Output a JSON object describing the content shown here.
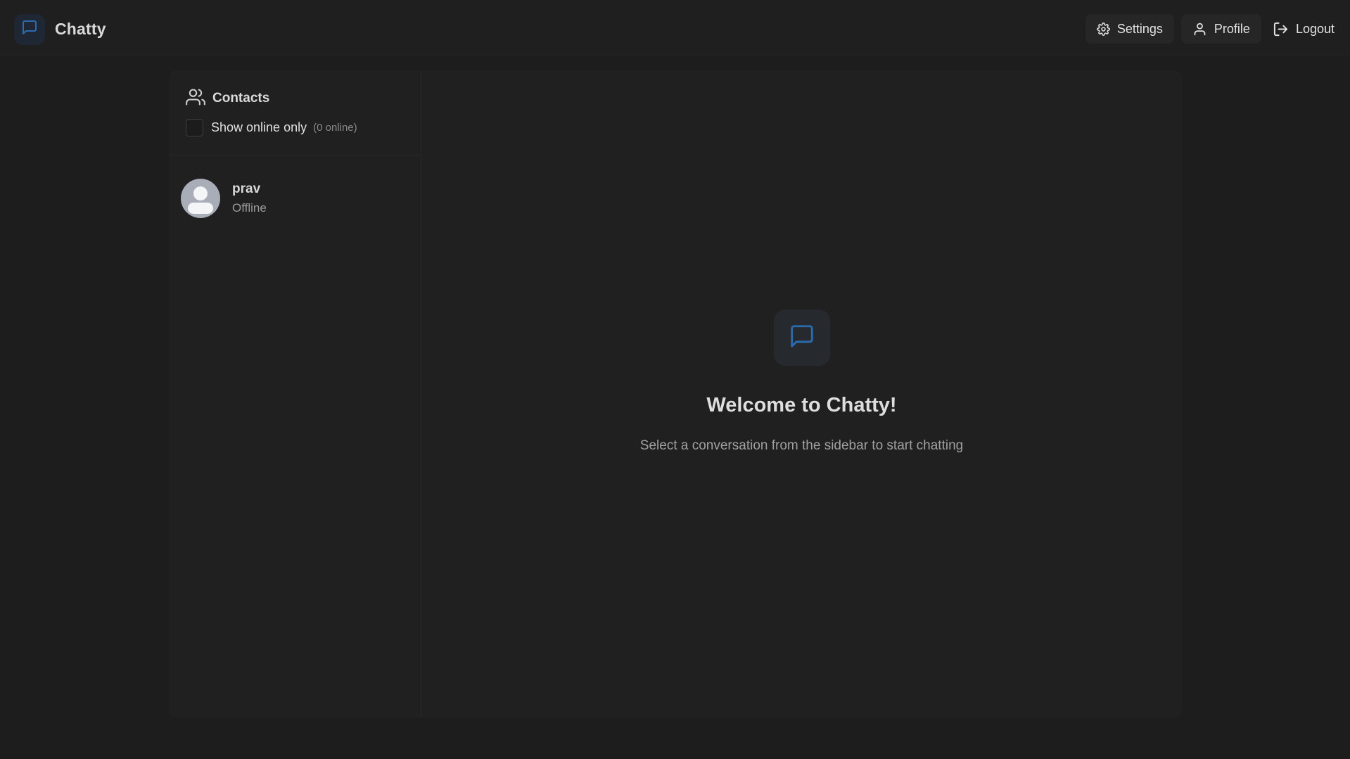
{
  "app": {
    "title": "Chatty",
    "accent_color": "#2b6cb0"
  },
  "header": {
    "brand_icon": "message-square-icon",
    "nav": {
      "settings_label": "Settings",
      "settings_icon": "gear-icon",
      "profile_label": "Profile",
      "profile_icon": "user-icon",
      "logout_label": "Logout",
      "logout_icon": "log-out-icon"
    }
  },
  "sidebar": {
    "title": "Contacts",
    "title_icon": "users-icon",
    "filter": {
      "label": "Show online only",
      "checked": false,
      "online_count": "(0 online)"
    },
    "contacts": [
      {
        "name": "prav",
        "status": "Offline"
      }
    ]
  },
  "main": {
    "welcome_icon": "message-square-icon",
    "welcome_title": "Welcome to Chatty!",
    "welcome_subtitle": "Select a conversation from the sidebar to start chatting"
  }
}
